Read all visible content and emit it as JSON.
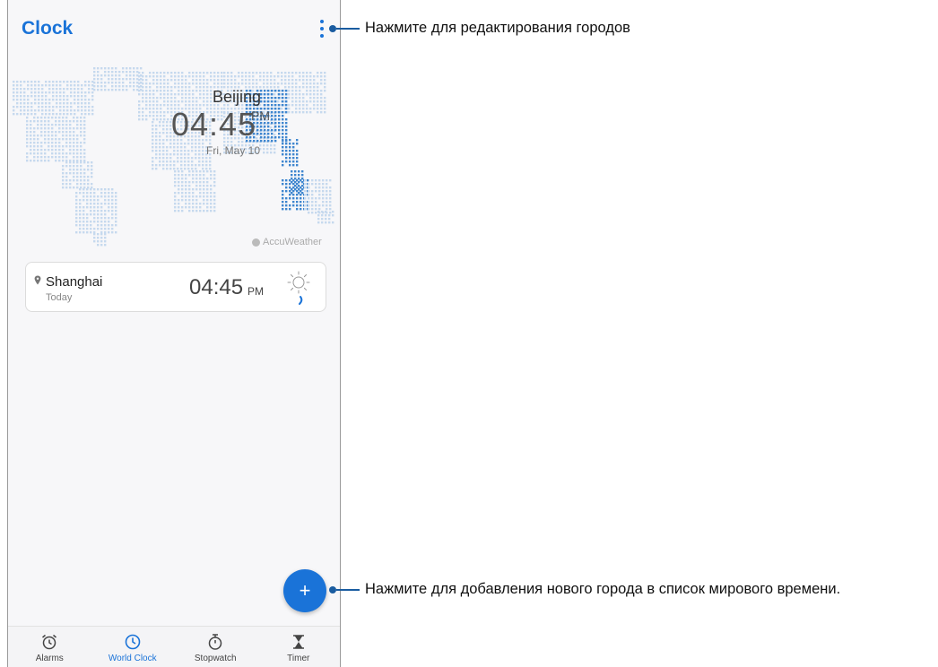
{
  "app": {
    "title": "Clock"
  },
  "map": {
    "city": "Beijing",
    "time": "04:45",
    "ampm": "PM",
    "date": "Fri, May 10",
    "attribution": "AccuWeather"
  },
  "world_clock_list": [
    {
      "city": "Shanghai",
      "day": "Today",
      "time": "04:45",
      "ampm": "PM",
      "weather_icon": "sun-moon-icon"
    }
  ],
  "fab": {
    "label": "+"
  },
  "bottom_nav": [
    {
      "label": "Alarms",
      "icon": "alarm-clock-icon",
      "active": false
    },
    {
      "label": "World Clock",
      "icon": "clock-icon",
      "active": true
    },
    {
      "label": "Stopwatch",
      "icon": "stopwatch-icon",
      "active": false
    },
    {
      "label": "Timer",
      "icon": "hourglass-icon",
      "active": false
    }
  ],
  "callouts": {
    "edit_cities": "Нажмите для редактирования городов",
    "add_city": "Нажмите для добавления нового города в список мирового времени."
  },
  "colors": {
    "accent": "#1a73d8",
    "callout_line": "#1a5ca0"
  }
}
